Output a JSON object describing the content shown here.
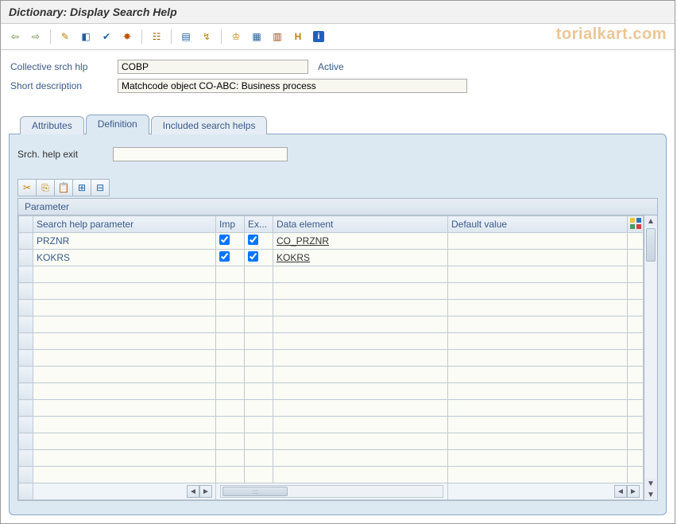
{
  "window": {
    "title": "Dictionary: Display Search Help"
  },
  "watermark": "torialkart.com",
  "toolbar_icons": [
    "arrow-left-icon",
    "arrow-right-icon",
    "sep",
    "display-change-icon",
    "other-object-icon",
    "check-icon",
    "activate-icon",
    "sep",
    "where-used-icon",
    "sep",
    "display-list-icon",
    "object-directory-icon",
    "sep",
    "hierarchy-icon",
    "append-icon",
    "technical-icon",
    "documentation-icon",
    "info-icon"
  ],
  "form": {
    "srch_hlp_label": "Collective srch hlp",
    "srch_hlp_value": "COBP",
    "status": "Active",
    "short_desc_label": "Short description",
    "short_desc_value": "Matchcode object CO-ABC: Business process"
  },
  "tabs": {
    "items": [
      "Attributes",
      "Definition",
      "Included search helps"
    ],
    "active_index": 1
  },
  "definition": {
    "exit_label": "Srch. help exit",
    "exit_value": "",
    "mini_icons": [
      "cut-icon",
      "copy-icon",
      "paste-icon",
      "insert-row-icon",
      "delete-row-icon"
    ],
    "table_title": "Parameter",
    "columns": {
      "param": "Search help parameter",
      "imp": "Imp",
      "exp": "Ex...",
      "data_elem": "Data element",
      "default": "Default value"
    },
    "rows": [
      {
        "param": "PRZNR",
        "imp": true,
        "exp": true,
        "data_elem": "CO_PRZNR",
        "default": ""
      },
      {
        "param": "KOKRS",
        "imp": true,
        "exp": true,
        "data_elem": "KOKRS",
        "default": ""
      }
    ],
    "empty_rows": 13
  }
}
